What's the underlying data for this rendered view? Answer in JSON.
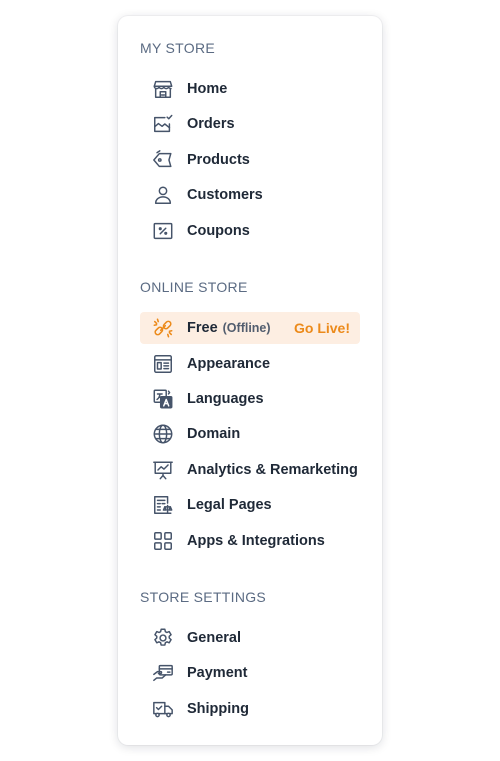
{
  "colors": {
    "section_title": "#5b6b83",
    "label": "#1f2937",
    "icon": "#46546a",
    "accent": "#ec8a1a",
    "active_bg": "#fdeee2"
  },
  "my_store": {
    "title": "MY STORE",
    "items": [
      {
        "label": "Home",
        "icon": "store-icon"
      },
      {
        "label": "Orders",
        "icon": "orders-icon"
      },
      {
        "label": "Products",
        "icon": "tag-icon"
      },
      {
        "label": "Customers",
        "icon": "user-icon"
      },
      {
        "label": "Coupons",
        "icon": "percent-icon"
      }
    ]
  },
  "online_store": {
    "title": "ONLINE STORE",
    "plan": {
      "label": "Free",
      "status": "(Offline)",
      "action": "Go Live!",
      "icon": "link-icon"
    },
    "items": [
      {
        "label": "Appearance",
        "icon": "layout-icon"
      },
      {
        "label": "Languages",
        "icon": "language-icon"
      },
      {
        "label": "Domain",
        "icon": "globe-icon"
      },
      {
        "label": "Analytics & Remarketing",
        "icon": "presentation-chart-icon"
      },
      {
        "label": "Legal Pages",
        "icon": "legal-icon"
      },
      {
        "label": "Apps & Integrations",
        "icon": "apps-grid-icon"
      }
    ]
  },
  "store_settings": {
    "title": "STORE SETTINGS",
    "items": [
      {
        "label": "General",
        "icon": "gear-icon"
      },
      {
        "label": "Payment",
        "icon": "payment-icon"
      },
      {
        "label": "Shipping",
        "icon": "truck-icon"
      }
    ]
  }
}
